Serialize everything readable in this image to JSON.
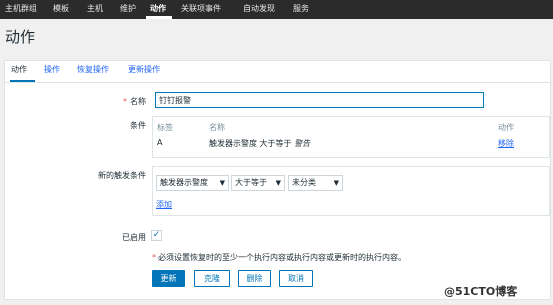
{
  "topnav": {
    "items": [
      {
        "label": "主机群组",
        "active": false
      },
      {
        "label": "模板",
        "active": false
      },
      {
        "label": "主机",
        "active": false
      },
      {
        "label": "维护",
        "active": false
      },
      {
        "label": "动作",
        "active": true
      },
      {
        "label": "关联项事件",
        "active": false
      },
      {
        "label": "自动发现",
        "active": false
      },
      {
        "label": "服务",
        "active": false
      }
    ]
  },
  "page": {
    "title": "动作"
  },
  "tabs": [
    {
      "label": "动作",
      "active": true
    },
    {
      "label": "操作",
      "active": false
    },
    {
      "label": "恢复操作",
      "active": false
    },
    {
      "label": "更新操作",
      "active": false
    }
  ],
  "form": {
    "name_label": "名称",
    "name_value": "钉钉报警",
    "conditions_label": "条件",
    "conditions_table": {
      "headers": {
        "label": "标签",
        "name": "名称",
        "action": "动作"
      },
      "rows": [
        {
          "label": "A",
          "name_prefix": "触发器示警度 大于等于 ",
          "name_value": "警告",
          "action": "移除"
        }
      ]
    },
    "new_condition_label": "新的触发条件",
    "new_condition": {
      "type": "触发器示警度",
      "operator": "大于等于",
      "value": "未分类",
      "add_link": "添加"
    },
    "enabled_label": "已启用",
    "enabled": true,
    "note": "必须设置恢复时的至少一个执行内容或执行内容或更新时的执行内容。"
  },
  "buttons": {
    "update": "更新",
    "clone": "克隆",
    "delete": "删除",
    "cancel": "取消"
  },
  "watermark": {
    "text": "@51CTO博客"
  },
  "colors": {
    "nav_bg": "#2b2b2b",
    "accent": "#0275b8",
    "link": "#1f65f4",
    "required": "#e45959"
  }
}
